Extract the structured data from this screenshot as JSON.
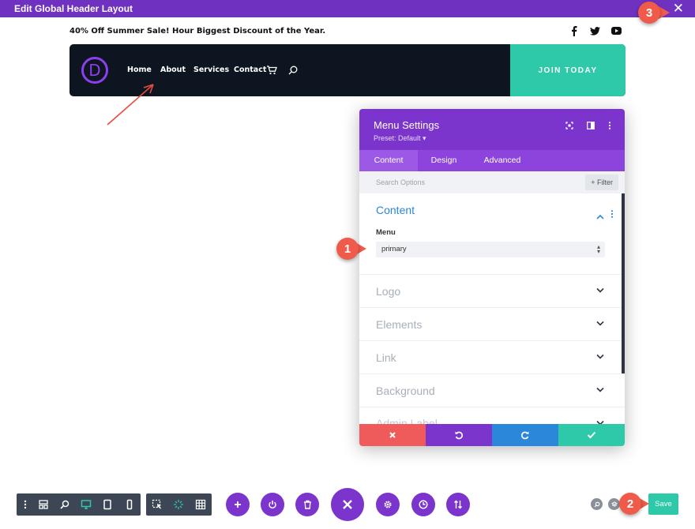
{
  "titlebar": {
    "title": "Edit Global Header Layout"
  },
  "promo": {
    "text": "40% Off Summer Sale! Hour Biggest Discount of the Year."
  },
  "social": {
    "icons": [
      "facebook-icon",
      "twitter-icon",
      "youtube-icon"
    ]
  },
  "header": {
    "logo_letter": "D",
    "nav": [
      "Home",
      "About",
      "Services",
      "Contact"
    ],
    "cta": "JOIN TODAY"
  },
  "annotations": {
    "one": "1",
    "two": "2",
    "three": "3"
  },
  "panel": {
    "title": "Menu Settings",
    "preset": "Preset: Default ▾",
    "tabs": [
      "Content",
      "Design",
      "Advanced"
    ],
    "active_tab": "Content",
    "search_placeholder": "Search Options",
    "filter_label": "+ Filter",
    "open_section": "Content",
    "menu_label": "Menu",
    "menu_value": "primary",
    "sections": [
      "Logo",
      "Elements",
      "Link",
      "Background",
      "Admin Label"
    ]
  },
  "save_label": "Save",
  "colors": {
    "purple": "#7b35cc",
    "titlebar": "#6f31bf",
    "teal": "#2ec9a8",
    "red": "#ef5a4a",
    "blue": "#2b87da",
    "dark": "#0d1520",
    "toolbar": "#3c4654"
  }
}
